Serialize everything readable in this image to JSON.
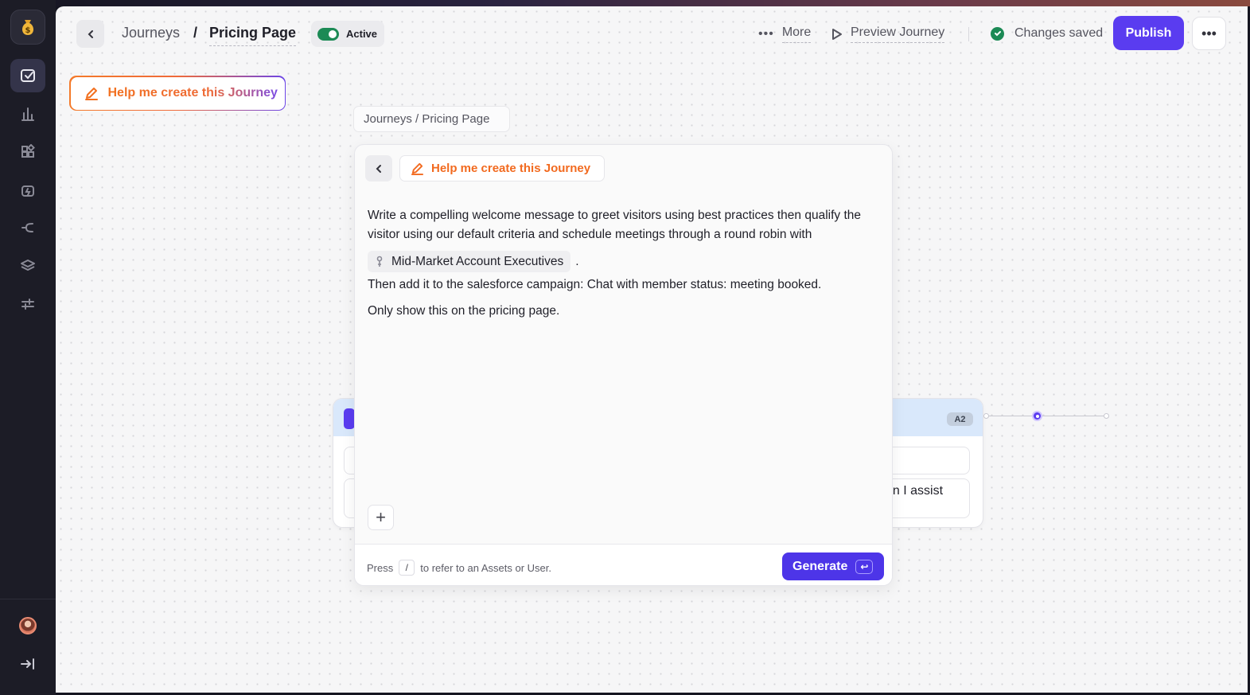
{
  "header": {
    "crumb_root": "Journeys",
    "crumb_sep": "/",
    "crumb_title": "Pricing Page",
    "status": "Active",
    "more": "More",
    "preview": "Preview Journey",
    "saved": "Changes saved",
    "publish": "Publish"
  },
  "help_button": {
    "label": "Help me create this Journey"
  },
  "chip_crumb": "Journeys / Pricing Page",
  "node": {
    "badge": "A2",
    "snippet": "an I assist"
  },
  "panel": {
    "help_label": "Help me create this Journey",
    "prompt_line1": "Write a compelling welcome message to greet visitors using best practices then qualify the visitor using our default criteria and schedule meetings through a round robin with",
    "mention": "Mid-Market Account Executives",
    "mention_suffix": ".",
    "prompt_line2": "Then add it to the salesforce campaign: Chat with member status: meeting booked.",
    "prompt_line3": "Only show this on the pricing page.",
    "hint_press": "Press",
    "hint_key": "/",
    "hint_rest": "to refer to an Assets or User.",
    "generate": "Generate"
  },
  "sidebar": {
    "icons": [
      "money-bag-icon",
      "journeys-icon",
      "analytics-icon",
      "widgets-icon",
      "automation-icon",
      "routing-icon",
      "layers-icon",
      "settings-sliders-icon",
      "avatar",
      "collapse-icon"
    ]
  },
  "colors": {
    "accent": "#5a3cf0",
    "active": "#1c8a55",
    "brand_orange": "#f26a1f"
  }
}
